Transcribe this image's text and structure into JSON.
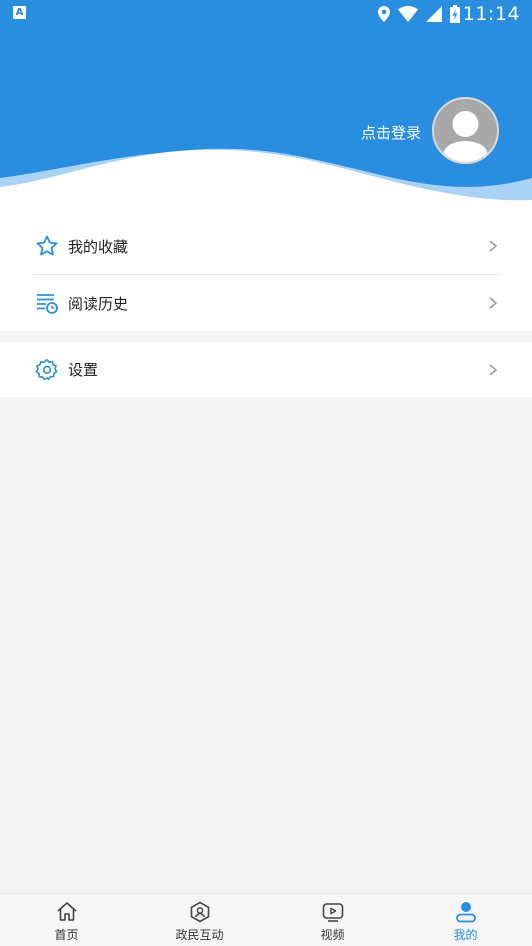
{
  "status_bar": {
    "time": "11:14",
    "app_icon_letter": "A"
  },
  "header": {
    "login_text": "点击登录",
    "bg_color": "#2a8ee0"
  },
  "menu": {
    "favorites": {
      "label": "我的收藏",
      "icon": "star-icon"
    },
    "history": {
      "label": "阅读历史",
      "icon": "reading-history-icon"
    },
    "settings": {
      "label": "设置",
      "icon": "gear-icon"
    }
  },
  "tabbar": {
    "active_color": "#2a8ee0",
    "tabs": [
      {
        "label": "首页",
        "icon": "home-icon",
        "active": false
      },
      {
        "label": "政民互动",
        "icon": "interaction-icon",
        "active": false
      },
      {
        "label": "视频",
        "icon": "video-icon",
        "active": false
      },
      {
        "label": "我的",
        "icon": "user-icon",
        "active": true
      }
    ]
  }
}
